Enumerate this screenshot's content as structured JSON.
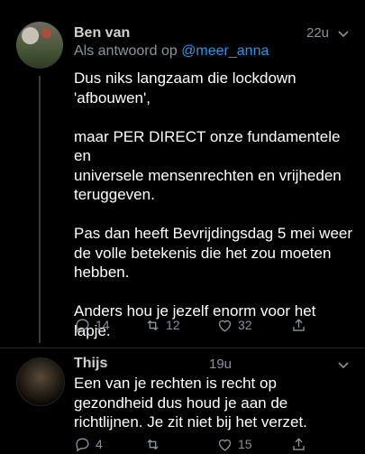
{
  "tweets": [
    {
      "name": "Ben van",
      "time": "22u",
      "reply_prefix": "Als antwoord op ",
      "reply_handle": "@meer_anna",
      "text": "Dus niks langzaam die lockdown\n'afbouwen',\n\nmaar PER DIRECT onze fundamentele en\nuniversele mensenrechten en vrijheden\nteruggeven.\n\nPas dan heeft Bevrijdingsdag 5 mei weer\nde volle betekenis die het zou moeten\nhebben.\n\nAnders hou je jezelf enorm voor het\nlapje.",
      "replies": "14",
      "retweets": "12",
      "likes": "32"
    },
    {
      "name": "Thijs",
      "time": "19u",
      "text": "Een van je rechten is recht op\ngezondheid dus houd je aan de\nrichtlijnen. Je zit niet bij het verzet.",
      "replies": "4",
      "retweets": "",
      "likes": "15"
    }
  ],
  "colors": {
    "background": "#000000",
    "text": "#ffffff",
    "secondary": "#8a939c",
    "link": "#1d9bf0",
    "thread_line": "#3b3b3b"
  },
  "icons": [
    "comment-icon",
    "retweet-icon",
    "heart-icon",
    "share-icon",
    "chevron-down-icon"
  ]
}
